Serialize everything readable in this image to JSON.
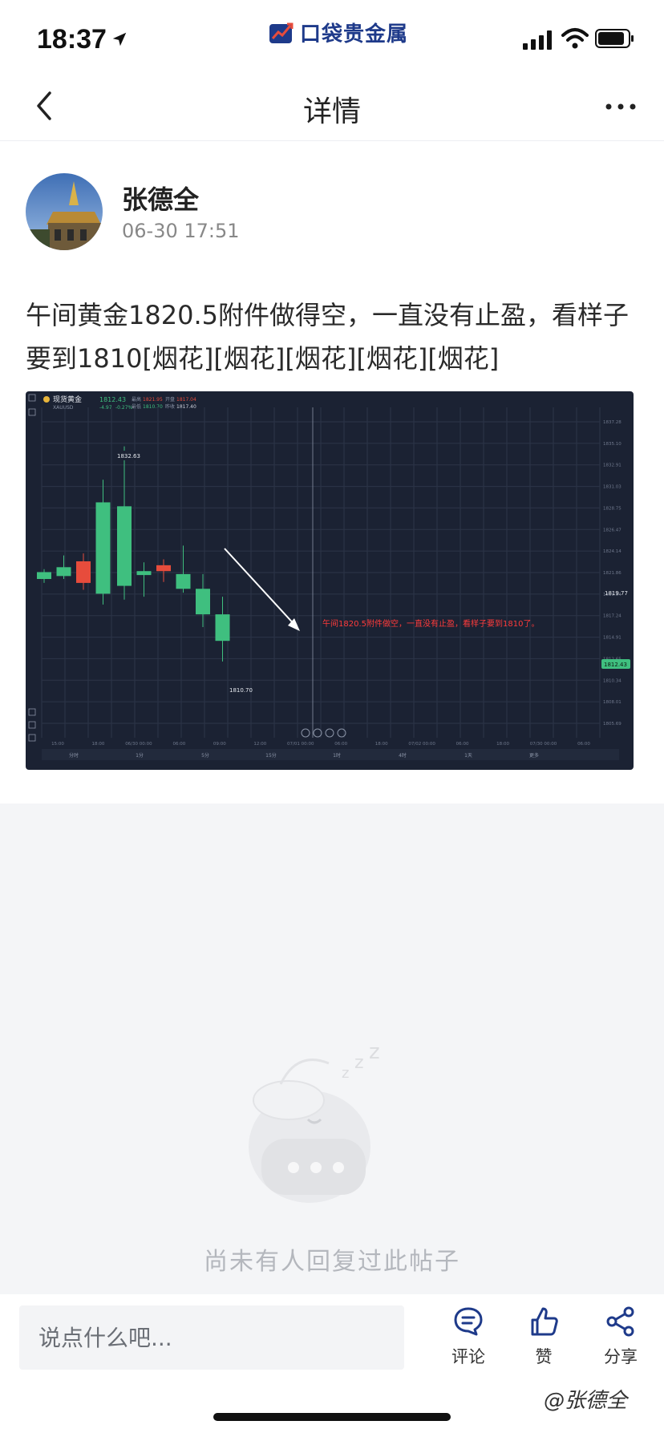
{
  "status_bar": {
    "time": "18:37",
    "brand_name": "口袋贵金属"
  },
  "nav": {
    "title": "详情"
  },
  "post": {
    "author": "张德全",
    "time": "06-30 17:51",
    "text": "午间黄金1820.5附件做得空，一直没有止盈，看样子要到1810[烟花][烟花][烟花][烟花][烟花]",
    "image": {
      "symbol": "现货黄金",
      "symbol_code": "XAUUSD",
      "last_price": "1812.43",
      "change": "-4.97",
      "change_pct": "-0.27%",
      "high_label": "最高",
      "high_value": "1821.95",
      "open_label": "开盘",
      "open_value": "1817.04",
      "low_label": "最低",
      "low_value": "1810.70",
      "prev_label": "昨收",
      "prev_value": "1817.40",
      "peak_label": "1832.63",
      "low_marker": "1810.70",
      "annotation": "午间1820.5附件做空，一直没有止盈，看样子要到1810了。",
      "price_tag_1": "1819.77",
      "price_tag_2": "1812.43",
      "y_ticks": [
        "1837.28",
        "1835.10",
        "1832.91",
        "1831.03",
        "1828.75",
        "1826.47",
        "1824.14",
        "1821.86",
        "1819.54",
        "1817.24",
        "1814.91",
        "1812.65",
        "1810.34",
        "1808.01",
        "1805.69"
      ],
      "x_ticks": [
        "15:00",
        "18:00",
        "06/30 00:00",
        "06:00",
        "09:00",
        "12:00",
        "07/01 00:00",
        "06:00",
        "18:00",
        "07/02 00:00",
        "06:00",
        "18:00",
        "07/30 00:00",
        "06:00"
      ],
      "timeframes": [
        "分时",
        "1分",
        "5分",
        "15分",
        "1时",
        "4时",
        "1天",
        "更多"
      ]
    }
  },
  "replies": {
    "empty_text": "尚未有人回复过此帖子"
  },
  "bottom": {
    "input_placeholder": "说点什么吧...",
    "comment_label": "评论",
    "like_label": "赞",
    "share_label": "分享"
  },
  "watermark": "@张德全",
  "colors": {
    "up": "#e74c3c",
    "down": "#3fbf7f",
    "chart_bg": "#1b2233",
    "brand": "#1e3a8a"
  }
}
